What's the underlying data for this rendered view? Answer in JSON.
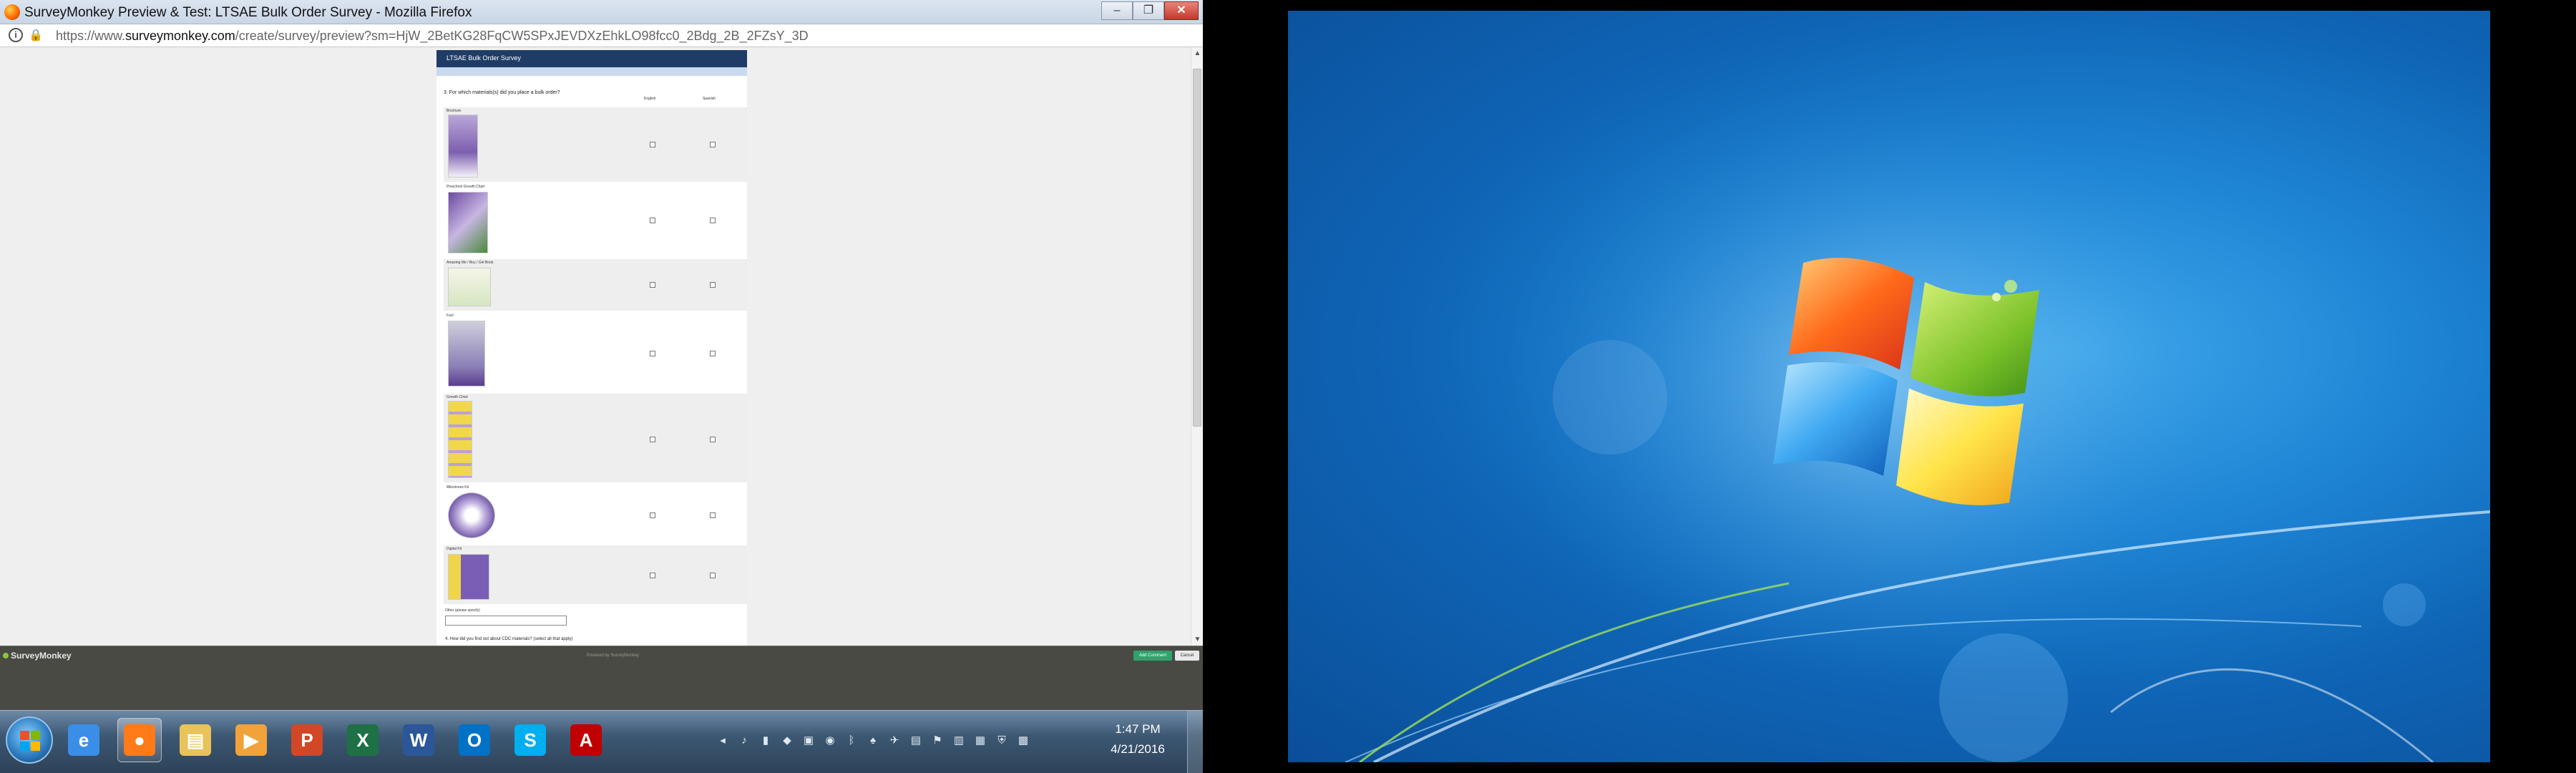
{
  "window": {
    "title": "SurveyMonkey Preview & Test: LTSAE Bulk Order Survey - Mozilla Firefox",
    "minimize": "–",
    "maximize": "❐",
    "close": "✕"
  },
  "address_bar": {
    "url_prefix": "https://www.",
    "url_domain": "surveymonkey.com",
    "url_rest": "/create/survey/preview?sm=HjW_2BetKG28FqCW5SPxJEVDXzEhkLO98fcc0_2Bdg_2B_2FZsY_3D",
    "info_icon": "i",
    "lock_icon": "🔒"
  },
  "survey": {
    "header_title": "LTSAE Bulk Order Survey",
    "question": "3. For which materials(s) did you place a bulk order?",
    "columns": [
      "English",
      "Spanish"
    ],
    "items": [
      {
        "label": "Brochure"
      },
      {
        "label": "Preschool Growth Chart"
      },
      {
        "label": "Amazing Me / Boy / Girl Book"
      },
      {
        "label": "Fact"
      },
      {
        "label": "Growth Chart"
      },
      {
        "label": "Milestones Kit"
      },
      {
        "label": "Digital Kit"
      }
    ],
    "other_label": "Other (please specify)",
    "next_question": "4. How did you find out about CDC materials? (select all that apply)"
  },
  "footer_bar": {
    "logo": "SurveyMonkey",
    "middle_text": "Powered by SurveyMonkey",
    "primary_button": "Add Comment",
    "secondary_button": "Cancel"
  },
  "taskbar": {
    "apps": [
      {
        "name": "internet-explorer",
        "glyph": "e",
        "color": "#3a8ee6"
      },
      {
        "name": "firefox",
        "glyph": "●",
        "color": "#ff7a18"
      },
      {
        "name": "file-explorer",
        "glyph": "▤",
        "color": "#e8c35a"
      },
      {
        "name": "media-player",
        "glyph": "▶",
        "color": "#f2a23a"
      },
      {
        "name": "powerpoint",
        "glyph": "P",
        "color": "#d24726"
      },
      {
        "name": "excel",
        "glyph": "X",
        "color": "#1e7145"
      },
      {
        "name": "word",
        "glyph": "W",
        "color": "#2b579a"
      },
      {
        "name": "outlook",
        "glyph": "O",
        "color": "#0072c6"
      },
      {
        "name": "skype",
        "glyph": "S",
        "color": "#00aff0"
      },
      {
        "name": "acrobat",
        "glyph": "A",
        "color": "#c00000"
      }
    ],
    "time": "1:47 PM",
    "date": "4/21/2016"
  },
  "colors": {
    "survey_header": "#1f3c66",
    "desktop_blue": "#1f86d6",
    "taskbar": "#3d5873"
  }
}
